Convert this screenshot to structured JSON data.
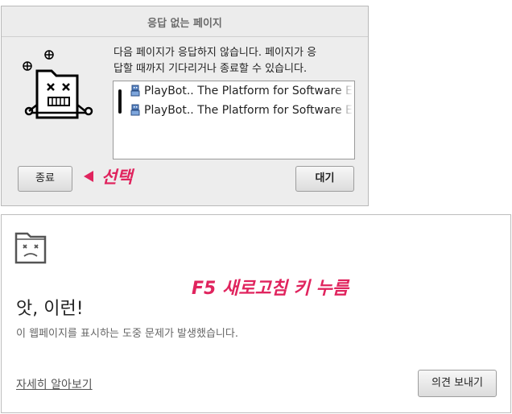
{
  "dialog": {
    "title": "응답 없는 페이지",
    "message": "다음 페이지가 응답하지 않습니다. 페이지가 응\n답할 때까지 기다리거나 종료할 수 있습니다.",
    "pages": [
      {
        "label": "PlayBot.. The Platform for Software E",
        "icon": "robot-icon"
      },
      {
        "label": "PlayBot.. The Platform for Software E",
        "icon": "robot-icon"
      }
    ],
    "end_button": "종료",
    "wait_button": "대기",
    "icon": "dead-folder-icon"
  },
  "annotations": {
    "select": "선택",
    "refresh": "F5 새로고침 키 누름",
    "color": "#e0245e"
  },
  "error_page": {
    "icon": "sad-folder-icon",
    "title": "앗, 이런!",
    "description": "이 웹페이지를 표시하는 도중 문제가 발생했습니다.",
    "learn_more": "자세히 알아보기",
    "feedback_button": "의견 보내기"
  }
}
